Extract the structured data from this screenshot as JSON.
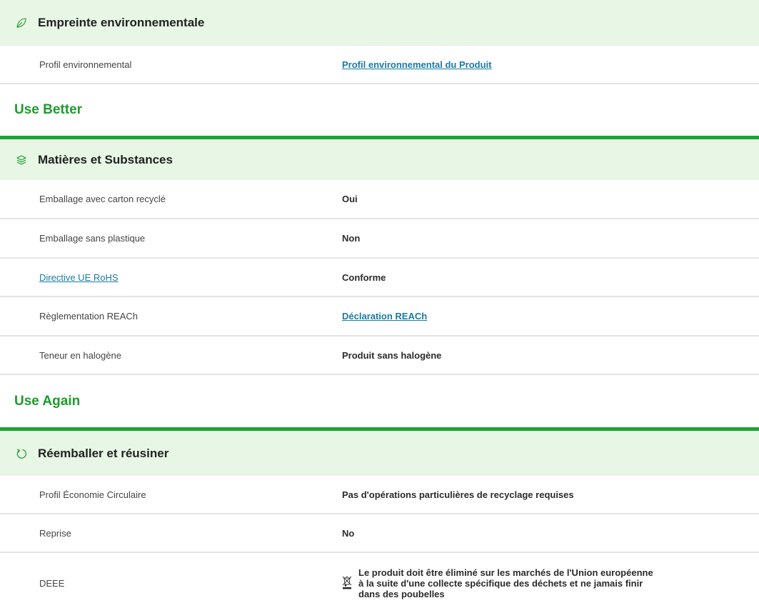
{
  "sections": {
    "footprint": {
      "title": "Empreinte environnementale",
      "icon": "leaf-icon",
      "rows": [
        {
          "label": "Profil environnemental",
          "value": "Profil environnemental du Produit"
        }
      ]
    },
    "use_better": {
      "group_title": "Use Better",
      "title": "Matières et Substances",
      "icon": "layers-icon",
      "rows": [
        {
          "label": "Emballage avec carton recyclé",
          "value": "Oui"
        },
        {
          "label": "Emballage sans plastique",
          "value": "Non"
        },
        {
          "label": "Directive UE RoHS",
          "value": "Conforme"
        },
        {
          "label": "Règlementation REACh",
          "value": "Déclaration REACh"
        },
        {
          "label": "Teneur en halogène",
          "value": "Produit sans halogène"
        }
      ]
    },
    "use_again": {
      "group_title": "Use Again",
      "title": "Réemballer et réusiner",
      "icon": "recycle-arrow-icon",
      "rows": [
        {
          "label": "Profil Économie Circulaire",
          "value": "Pas d'opérations particulières de recyclage requises"
        },
        {
          "label": "Reprise",
          "value": "No"
        },
        {
          "label": "DEEE",
          "value": "Le produit doit être éliminé sur les marchés de l'Union européenne à la suite d'une collecte spécifique des déchets et ne jamais finir dans des poubelles",
          "icon": "crossed-bin-icon"
        }
      ]
    }
  },
  "colors": {
    "header_bg": "#e7f6e5",
    "accent_green": "#1ea335",
    "group_title_green": "#1e9b2e",
    "link_blue": "#1a7aa6",
    "divider_gray": "#e4e4e4"
  }
}
